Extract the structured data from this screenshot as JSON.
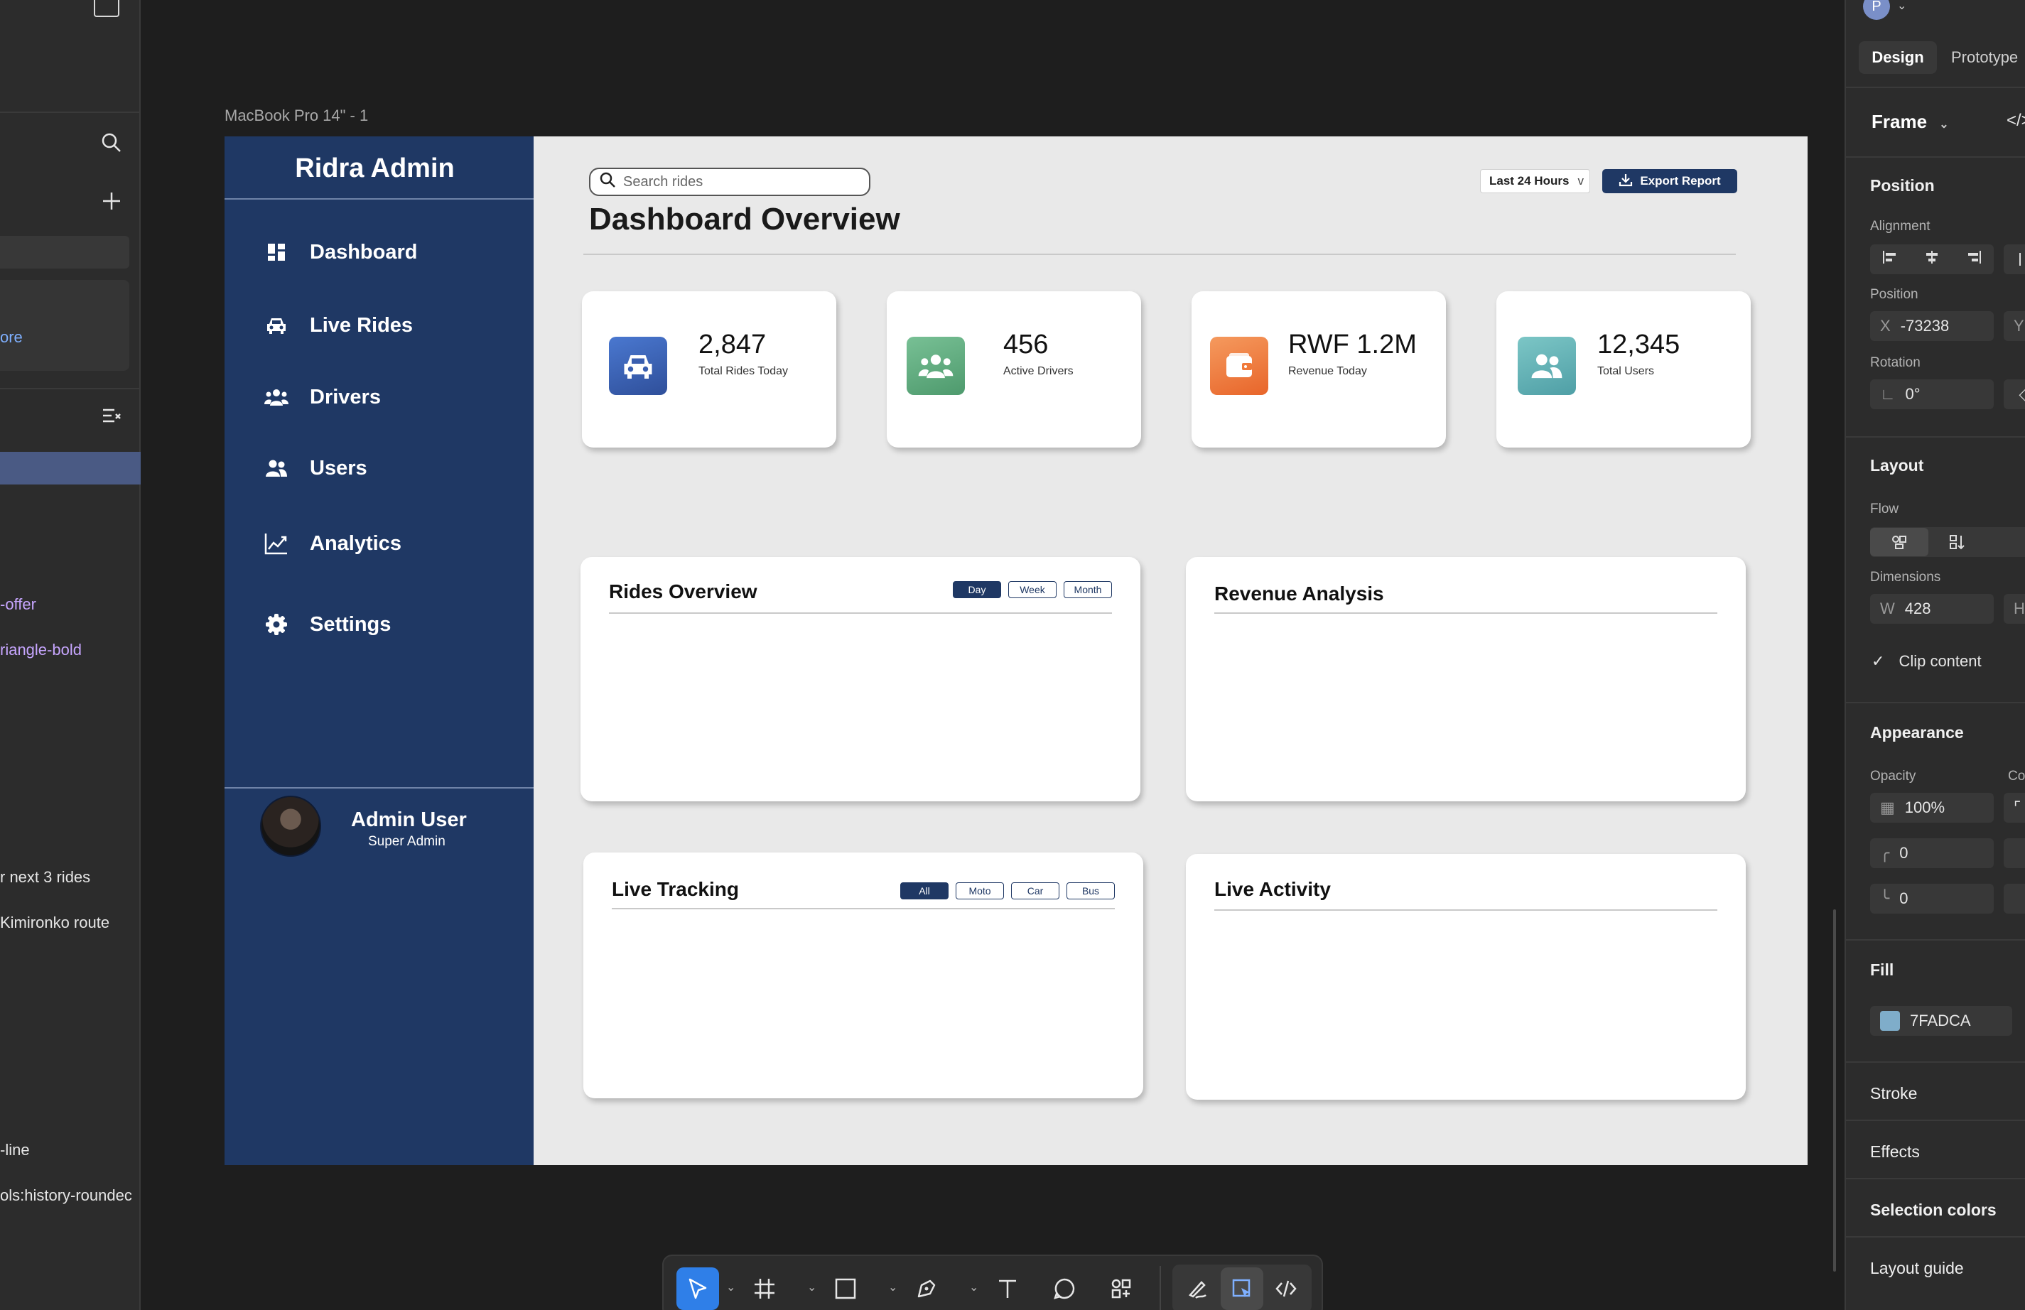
{
  "left_panel": {
    "items": [
      {
        "text": "ore",
        "style": "blue"
      },
      {
        "text": "-offer",
        "style": "purple"
      },
      {
        "text": "riangle-bold",
        "style": "purple"
      },
      {
        "text": "r next 3 rides"
      },
      {
        "text": " Kimironko route"
      },
      {
        "text": "-line"
      },
      {
        "text": "ols:history-roundec"
      }
    ]
  },
  "frame": {
    "label": "MacBook Pro 14\" - 1"
  },
  "sidebar": {
    "brand": "Ridra Admin",
    "nav": [
      {
        "label": "Dashboard",
        "icon": "dashboard-icon"
      },
      {
        "label": "Live Rides",
        "icon": "car-icon"
      },
      {
        "label": "Drivers",
        "icon": "drivers-icon"
      },
      {
        "label": "Users",
        "icon": "users-icon"
      },
      {
        "label": "Analytics",
        "icon": "chart-line-icon"
      },
      {
        "label": "Settings",
        "icon": "gear-icon"
      }
    ],
    "profile": {
      "name": "Admin User",
      "role": "Super Admin"
    }
  },
  "header": {
    "search_placeholder": "Search rides",
    "title": "Dashboard Overview",
    "range": "Last 24 Hours",
    "range_caret": "v",
    "export": "Export Report"
  },
  "stats": [
    {
      "value": "2,847",
      "label": "Total Rides Today",
      "color": "#3a5fb0",
      "icon": "car-icon"
    },
    {
      "value": "456",
      "label": "Active Drivers",
      "color": "#5fa97e",
      "icon": "drivers-icon"
    },
    {
      "value": "RWF 1.2M",
      "label": "Revenue Today",
      "color": "#f07a3a",
      "icon": "wallet-icon"
    },
    {
      "value": "12,345",
      "label": "Total Users",
      "color": "#5fb0b0",
      "icon": "users-icon"
    }
  ],
  "panels": {
    "rides_overview": {
      "title": "Rides Overview",
      "filters": [
        "Day",
        "Week",
        "Month"
      ],
      "active": "Day"
    },
    "revenue": {
      "title": "Revenue Analysis"
    },
    "live_tracking": {
      "title": "Live Tracking",
      "filters": [
        "All",
        "Moto",
        "Car",
        "Bus"
      ],
      "active": "All"
    },
    "live_activity": {
      "title": "Live Activity"
    }
  },
  "right_panel": {
    "avatar_letter": "P",
    "tabs": [
      "Design",
      "Prototype"
    ],
    "frame_label": "Frame",
    "position_title": "Position",
    "alignment_label": "Alignment",
    "position_label": "Position",
    "x_label": "X",
    "x_value": "-73238",
    "rotation_label": "Rotation",
    "rotation_value": "0°",
    "layout_title": "Layout",
    "flow_label": "Flow",
    "dimensions_label": "Dimensions",
    "w_label": "W",
    "w_value": "428",
    "clip_content": "Clip content",
    "appearance_title": "Appearance",
    "opacity_label": "Opacity",
    "opacity_value": "100%",
    "corner_label": "Co",
    "radius_value_1": "0",
    "radius_value_2": "0",
    "fill_title": "Fill",
    "fill_color": "#7FADCA",
    "fill_value": "7FADCA",
    "stroke_title": "Stroke",
    "effects_title": "Effects",
    "selection_colors_title": "Selection colors",
    "layout_guide_title": "Layout guide"
  },
  "colors": {
    "sidebar": "#1f3864",
    "accent": "#2f7fe8"
  }
}
